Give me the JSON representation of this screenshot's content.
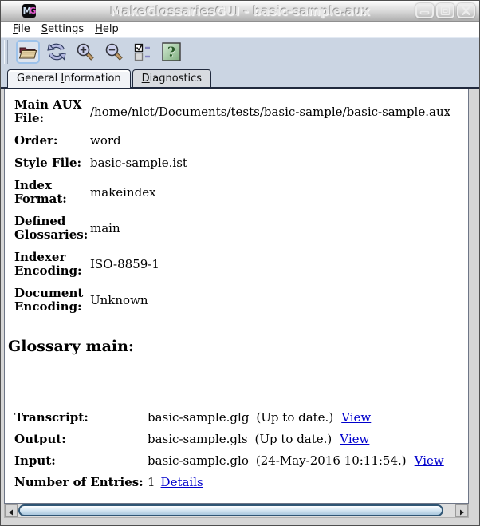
{
  "window": {
    "title": "MakeGlossariesGUI - basic-sample.aux",
    "icon_m": "M",
    "icon_g": "G"
  },
  "menu": {
    "items": [
      {
        "pre": "",
        "m": "F",
        "post": "ile"
      },
      {
        "pre": "",
        "m": "S",
        "post": "ettings"
      },
      {
        "pre": "",
        "m": "H",
        "post": "elp"
      }
    ]
  },
  "toolbar": {
    "buttons": [
      {
        "name": "open-file"
      },
      {
        "name": "reload"
      },
      {
        "name": "zoom-in"
      },
      {
        "name": "zoom-out"
      },
      {
        "name": "properties"
      },
      {
        "name": "help"
      }
    ]
  },
  "tabs": [
    {
      "pre": "General ",
      "m": "I",
      "post": "nformation",
      "state": "active"
    },
    {
      "pre": "",
      "m": "D",
      "post": "iagnostics",
      "state": "inactive"
    }
  ],
  "general": {
    "fields": [
      {
        "label": "Main AUX File:",
        "value": "/home/nlct/Documents/tests/basic-sample/basic-sample.aux"
      },
      {
        "label": "Order:",
        "value": "word"
      },
      {
        "label": "Style File:",
        "value": "basic-sample.ist"
      },
      {
        "label": "Index Format:",
        "value": "makeindex"
      },
      {
        "label": "Defined Glossaries:",
        "value": "main"
      },
      {
        "label": "Indexer Encoding:",
        "value": "ISO-8859-1"
      },
      {
        "label": "Document Encoding:",
        "value": "Unknown"
      }
    ],
    "glossary_heading": "Glossary main:",
    "glossary": [
      {
        "label": "Transcript:",
        "file": "basic-sample.glg",
        "status": "(Up to date.)",
        "link": "View"
      },
      {
        "label": "Output:",
        "file": "basic-sample.gls",
        "status": "(Up to date.)",
        "link": "View"
      },
      {
        "label": "Input:",
        "file": "basic-sample.glo",
        "status": "(24-May-2016 10:11:54.)",
        "link": "View"
      },
      {
        "label": "Number of Entries:",
        "file": "1",
        "status": "",
        "link": "Details"
      }
    ]
  },
  "colors": {
    "link": "#0000cc",
    "toolbar_bg": "#cbd5e3",
    "tab_border": "#20293d",
    "help_green": "#8fbe8f",
    "scroll_thumb": "#aac8de"
  }
}
